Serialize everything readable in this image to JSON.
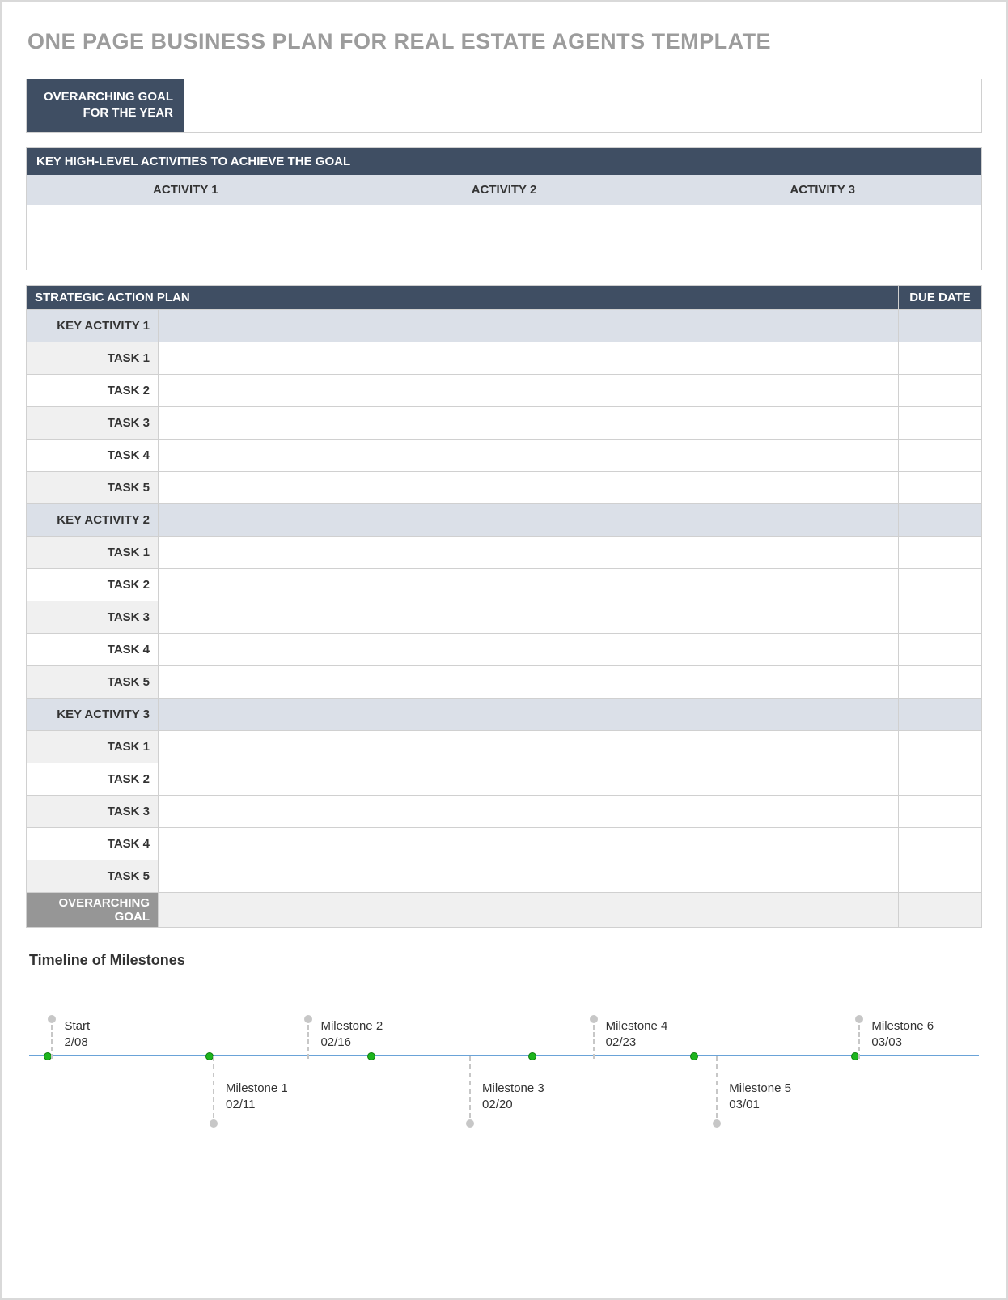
{
  "title": "ONE PAGE BUSINESS PLAN FOR REAL ESTATE AGENTS TEMPLATE",
  "goal": {
    "label": "OVERARCHING GOAL FOR THE YEAR",
    "value": ""
  },
  "activities": {
    "header": "KEY HIGH-LEVEL ACTIVITIES TO ACHIEVE THE GOAL",
    "cols": [
      "ACTIVITY 1",
      "ACTIVITY 2",
      "ACTIVITY 3"
    ],
    "values": [
      "",
      "",
      ""
    ]
  },
  "plan": {
    "header": "STRATEGIC ACTION PLAN",
    "due_header": "DUE DATE",
    "groups": [
      {
        "key": "KEY ACTIVITY 1",
        "tasks": [
          "TASK 1",
          "TASK 2",
          "TASK 3",
          "TASK 4",
          "TASK 5"
        ]
      },
      {
        "key": "KEY ACTIVITY 2",
        "tasks": [
          "TASK 1",
          "TASK 2",
          "TASK 3",
          "TASK 4",
          "TASK 5"
        ]
      },
      {
        "key": "KEY ACTIVITY 3",
        "tasks": [
          "TASK 1",
          "TASK 2",
          "TASK 3",
          "TASK 4",
          "TASK 5"
        ]
      }
    ],
    "overarching_label": "OVERARCHING GOAL"
  },
  "timeline": {
    "title": "Timeline of Milestones",
    "axis_ticks_pct": [
      2,
      19,
      36,
      53,
      70,
      87
    ],
    "items": [
      {
        "label": "Start",
        "date": "2/08",
        "pos_pct": 2,
        "side": "top"
      },
      {
        "label": "Milestone 1",
        "date": "02/11",
        "pos_pct": 19,
        "side": "bot"
      },
      {
        "label": "Milestone 2",
        "date": "02/16",
        "pos_pct": 29,
        "side": "top"
      },
      {
        "label": "Milestone 3",
        "date": "02/20",
        "pos_pct": 46,
        "side": "bot"
      },
      {
        "label": "Milestone 4",
        "date": "02/23",
        "pos_pct": 59,
        "side": "top"
      },
      {
        "label": "Milestone 5",
        "date": "03/01",
        "pos_pct": 72,
        "side": "bot"
      },
      {
        "label": "Milestone 6",
        "date": "03/03",
        "pos_pct": 87,
        "side": "top"
      }
    ]
  }
}
